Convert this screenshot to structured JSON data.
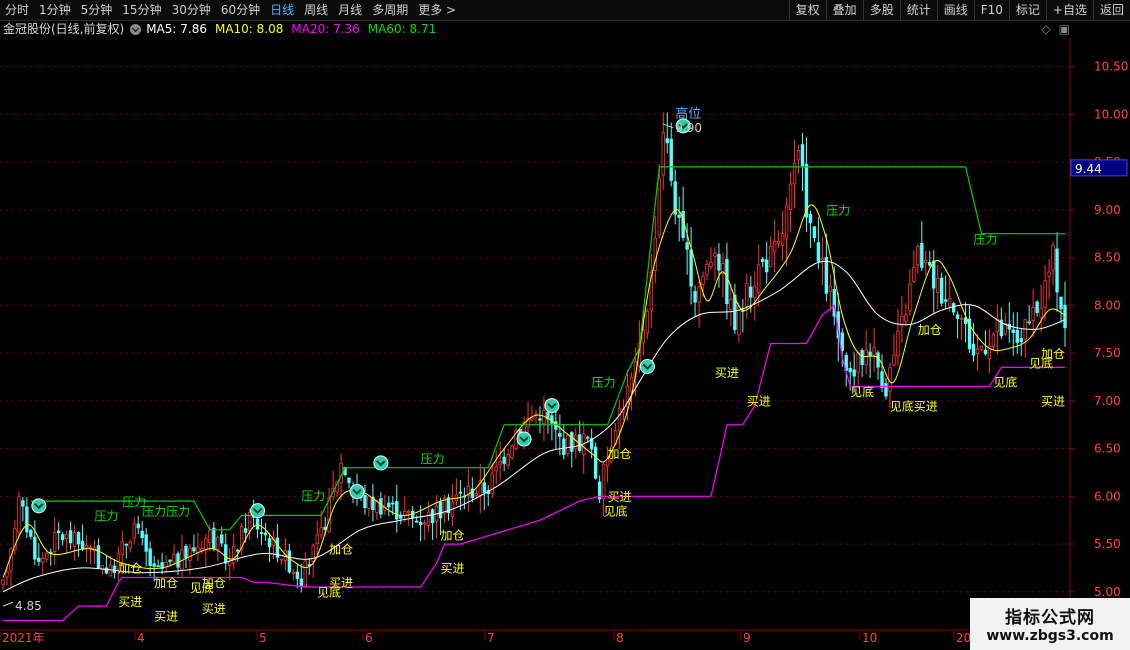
{
  "toolbar": {
    "periods": [
      "分时",
      "1分钟",
      "5分钟",
      "15分钟",
      "30分钟",
      "60分钟",
      "日线",
      "周线",
      "月线",
      "多周期",
      "更多 >"
    ],
    "active_period": "日线",
    "actions": [
      "复权",
      "叠加",
      "多股",
      "统计",
      "画线",
      "F10",
      "标记",
      "+自选",
      "返回"
    ]
  },
  "info": {
    "stock": "金冠股份(日线,前复权)",
    "ma5": "MA5: 7.86",
    "ma10": "MA10: 8.08",
    "ma20": "MA20: 7.36",
    "ma60": "MA60: 8.71"
  },
  "colors": {
    "up": "#ff3232",
    "down": "#54fcfc",
    "ma5": "#ffff00",
    "ma_white": "#ffffff",
    "support": "#ff00ff",
    "resistance": "#00d000",
    "label_yellow": "#ffff00",
    "label_green": "#00e000"
  },
  "watermark": {
    "line1": "指标公式网",
    "line2": "www.zbgs3.com"
  },
  "chart_data": {
    "type": "candlestick",
    "ylim": [
      4.6,
      10.8
    ],
    "y_ticks": [
      "10.50",
      "10.00",
      "9.50",
      "9.00",
      "8.50",
      "8.00",
      "7.50",
      "7.00",
      "6.50",
      "6.00",
      "5.50",
      "5.00"
    ],
    "price_tag": "9.44",
    "x_labels": [
      "2021年",
      "4",
      "5",
      "6",
      "7",
      "8",
      "9",
      "10",
      "20"
    ],
    "high_marker": {
      "text": "高位",
      "value": "9.90"
    },
    "low_marker": "4.85",
    "segments": [
      [
        0,
        5.05
      ],
      [
        4,
        5.95
      ],
      [
        9,
        5.3
      ],
      [
        14,
        5.6
      ],
      [
        20,
        5.5
      ],
      [
        27,
        5.2
      ],
      [
        33,
        5.7
      ],
      [
        38,
        5.2
      ],
      [
        45,
        5.35
      ],
      [
        52,
        5.6
      ],
      [
        57,
        5.3
      ],
      [
        62,
        5.8
      ],
      [
        68,
        5.5
      ],
      [
        75,
        5.15
      ],
      [
        80,
        5.6
      ],
      [
        85,
        6.35
      ],
      [
        90,
        5.95
      ],
      [
        97,
        5.9
      ],
      [
        104,
        5.75
      ],
      [
        110,
        5.85
      ],
      [
        116,
        6.05
      ],
      [
        122,
        6.1
      ],
      [
        129,
        6.7
      ],
      [
        135,
        6.9
      ],
      [
        141,
        6.55
      ],
      [
        147,
        6.6
      ],
      [
        150,
        6.05
      ],
      [
        154,
        6.8
      ],
      [
        159,
        7.3
      ],
      [
        163,
        8.3
      ],
      [
        166,
        9.9
      ],
      [
        170,
        8.8
      ],
      [
        174,
        8.1
      ],
      [
        179,
        8.65
      ],
      [
        184,
        7.8
      ],
      [
        190,
        8.4
      ],
      [
        195,
        8.6
      ],
      [
        200,
        9.55
      ],
      [
        204,
        8.6
      ],
      [
        208,
        8.1
      ],
      [
        212,
        7.2
      ],
      [
        218,
        7.6
      ],
      [
        222,
        7.15
      ],
      [
        226,
        7.8
      ],
      [
        230,
        8.55
      ],
      [
        235,
        8.2
      ],
      [
        240,
        8.0
      ],
      [
        244,
        7.5
      ],
      [
        250,
        7.75
      ],
      [
        255,
        7.65
      ],
      [
        260,
        7.9
      ],
      [
        264,
        8.5
      ],
      [
        267,
        7.8
      ]
    ],
    "ma_yellow": [
      [
        0,
        5.15
      ],
      [
        6,
        5.7
      ],
      [
        12,
        5.4
      ],
      [
        22,
        5.45
      ],
      [
        30,
        5.3
      ],
      [
        40,
        5.25
      ],
      [
        52,
        5.45
      ],
      [
        58,
        5.35
      ],
      [
        64,
        5.7
      ],
      [
        72,
        5.35
      ],
      [
        78,
        5.3
      ],
      [
        84,
        5.95
      ],
      [
        90,
        6.05
      ],
      [
        100,
        5.8
      ],
      [
        110,
        5.95
      ],
      [
        118,
        6.05
      ],
      [
        126,
        6.5
      ],
      [
        134,
        6.85
      ],
      [
        142,
        6.65
      ],
      [
        148,
        6.45
      ],
      [
        152,
        6.4
      ],
      [
        158,
        7.05
      ],
      [
        163,
        8.3
      ],
      [
        169,
        9.0
      ],
      [
        173,
        8.6
      ],
      [
        177,
        8.05
      ],
      [
        181,
        8.35
      ],
      [
        186,
        7.95
      ],
      [
        192,
        8.2
      ],
      [
        198,
        8.55
      ],
      [
        203,
        9.05
      ],
      [
        207,
        8.7
      ],
      [
        211,
        7.9
      ],
      [
        215,
        7.5
      ],
      [
        220,
        7.45
      ],
      [
        224,
        7.2
      ],
      [
        229,
        7.9
      ],
      [
        234,
        8.45
      ],
      [
        238,
        8.3
      ],
      [
        243,
        7.8
      ],
      [
        248,
        7.55
      ],
      [
        253,
        7.55
      ],
      [
        258,
        7.65
      ],
      [
        263,
        7.95
      ],
      [
        267,
        7.9
      ]
    ],
    "ma_white": [
      [
        0,
        5.0
      ],
      [
        8,
        5.15
      ],
      [
        20,
        5.25
      ],
      [
        35,
        5.2
      ],
      [
        50,
        5.25
      ],
      [
        65,
        5.4
      ],
      [
        78,
        5.35
      ],
      [
        90,
        5.65
      ],
      [
        100,
        5.75
      ],
      [
        112,
        5.85
      ],
      [
        124,
        6.1
      ],
      [
        136,
        6.45
      ],
      [
        146,
        6.55
      ],
      [
        154,
        6.8
      ],
      [
        160,
        7.2
      ],
      [
        167,
        7.65
      ],
      [
        175,
        7.9
      ],
      [
        185,
        7.95
      ],
      [
        195,
        8.15
      ],
      [
        205,
        8.45
      ],
      [
        212,
        8.35
      ],
      [
        220,
        7.9
      ],
      [
        228,
        7.8
      ],
      [
        236,
        7.95
      ],
      [
        244,
        8.0
      ],
      [
        252,
        7.8
      ],
      [
        260,
        7.75
      ],
      [
        267,
        7.85
      ]
    ],
    "support_line": [
      [
        0,
        4.7
      ],
      [
        15,
        4.7
      ],
      [
        19,
        4.85
      ],
      [
        26,
        4.85
      ],
      [
        29,
        5.1
      ],
      [
        30,
        5.15
      ],
      [
        60,
        5.15
      ],
      [
        63,
        5.1
      ],
      [
        66,
        5.1
      ],
      [
        76,
        5.05
      ],
      [
        105,
        5.05
      ],
      [
        109,
        5.3
      ],
      [
        111,
        5.5
      ],
      [
        115,
        5.5
      ],
      [
        135,
        5.75
      ],
      [
        145,
        5.95
      ],
      [
        150,
        6.0
      ],
      [
        178,
        6.0
      ],
      [
        181,
        6.55
      ],
      [
        182,
        6.75
      ],
      [
        186,
        6.75
      ],
      [
        189,
        6.95
      ],
      [
        193,
        7.6
      ],
      [
        202,
        7.6
      ],
      [
        206,
        7.9
      ],
      [
        209,
        8.0
      ],
      [
        211,
        7.45
      ],
      [
        213,
        7.15
      ],
      [
        248,
        7.15
      ],
      [
        251,
        7.35
      ],
      [
        267,
        7.35
      ]
    ],
    "resistance_line": [
      [
        7,
        5.95
      ],
      [
        48,
        5.95
      ],
      [
        52,
        5.65
      ],
      [
        57,
        5.65
      ],
      [
        60,
        5.8
      ],
      [
        80,
        5.8
      ],
      [
        86,
        6.3
      ],
      [
        88,
        6.3
      ],
      [
        122,
        6.3
      ],
      [
        126,
        6.75
      ],
      [
        152,
        6.75
      ],
      [
        157,
        7.3
      ],
      [
        160,
        7.55
      ],
      [
        165,
        9.45
      ],
      [
        242,
        9.45
      ],
      [
        246,
        8.75
      ],
      [
        267,
        8.75
      ]
    ],
    "labels": [
      {
        "text": "压力",
        "i": 26,
        "v": 5.75,
        "c": "g"
      },
      {
        "text": "压力",
        "i": 33,
        "v": 5.9,
        "c": "g"
      },
      {
        "text": "压力压力",
        "i": 41,
        "v": 5.8,
        "c": "g"
      },
      {
        "text": "压力",
        "i": 78,
        "v": 5.96,
        "c": "g"
      },
      {
        "text": "压力",
        "i": 108,
        "v": 6.35,
        "c": "g"
      },
      {
        "text": "压力",
        "i": 151,
        "v": 7.15,
        "c": "g"
      },
      {
        "text": "压力",
        "i": 210,
        "v": 8.95,
        "c": "g"
      },
      {
        "text": "压力",
        "i": 247,
        "v": 8.65,
        "c": "g"
      },
      {
        "text": "加仓",
        "i": 32,
        "v": 5.2,
        "c": "y"
      },
      {
        "text": "加仓",
        "i": 41,
        "v": 5.05,
        "c": "y"
      },
      {
        "text": "加仓",
        "i": 53,
        "v": 5.05,
        "c": "y"
      },
      {
        "text": "加仓",
        "i": 85,
        "v": 5.4,
        "c": "y"
      },
      {
        "text": "加仓",
        "i": 113,
        "v": 5.55,
        "c": "y"
      },
      {
        "text": "加仓",
        "i": 155,
        "v": 6.4,
        "c": "y"
      },
      {
        "text": "加仓",
        "i": 233,
        "v": 7.7,
        "c": "y"
      },
      {
        "text": "加仓",
        "i": 264,
        "v": 7.45,
        "c": "y"
      },
      {
        "text": "买进",
        "i": 32,
        "v": 4.85,
        "c": "y"
      },
      {
        "text": "买进",
        "i": 41,
        "v": 4.7,
        "c": "y"
      },
      {
        "text": "买进",
        "i": 53,
        "v": 4.78,
        "c": "y"
      },
      {
        "text": "买进",
        "i": 85,
        "v": 5.05,
        "c": "y"
      },
      {
        "text": "买进",
        "i": 113,
        "v": 5.2,
        "c": "y"
      },
      {
        "text": "买进",
        "i": 155,
        "v": 5.95,
        "c": "y"
      },
      {
        "text": "买进",
        "i": 182,
        "v": 7.25,
        "c": "y"
      },
      {
        "text": "买进",
        "i": 190,
        "v": 6.95,
        "c": "y"
      },
      {
        "text": "买进",
        "i": 232,
        "v": 6.9,
        "c": "y"
      },
      {
        "text": "买进",
        "i": 264,
        "v": 6.95,
        "c": "y"
      },
      {
        "text": "见底",
        "i": 50,
        "v": 5.0,
        "c": "y"
      },
      {
        "text": "见底",
        "i": 82,
        "v": 4.95,
        "c": "y"
      },
      {
        "text": "见底",
        "i": 154,
        "v": 5.8,
        "c": "y"
      },
      {
        "text": "见底",
        "i": 216,
        "v": 7.05,
        "c": "y"
      },
      {
        "text": "见底",
        "i": 226,
        "v": 6.9,
        "c": "y"
      },
      {
        "text": "见底",
        "i": 252,
        "v": 7.15,
        "c": "y"
      },
      {
        "text": "见底",
        "i": 261,
        "v": 7.35,
        "c": "y"
      }
    ],
    "markers": [
      [
        9,
        5.9
      ],
      [
        64,
        5.85
      ],
      [
        89,
        6.05
      ],
      [
        95,
        6.35
      ],
      [
        131,
        6.6
      ],
      [
        138,
        6.95
      ],
      [
        162,
        7.36
      ],
      [
        171,
        9.88
      ]
    ]
  }
}
